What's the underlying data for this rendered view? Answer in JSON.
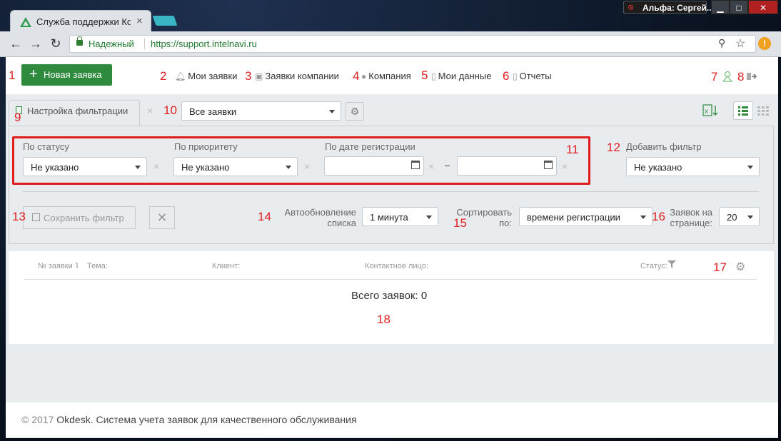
{
  "browser": {
    "tab_title": "Служба поддержки Ком",
    "tab_close": "×",
    "user_badge": "Альфа: Сергей...",
    "secure_label": "Надежный",
    "url": "https://support.intelnavi.ru",
    "window_buttons": [
      "▁",
      "□",
      "✕"
    ]
  },
  "header": {
    "new_ticket_label": "Новая заявка",
    "nav": [
      {
        "label": "Мои заявки",
        "icon": "bell-icon"
      },
      {
        "label": "Заявки компании",
        "icon": "briefcase-icon"
      },
      {
        "label": "Компания",
        "icon": "person-icon"
      },
      {
        "label": "Мои данные",
        "icon": "document-icon"
      },
      {
        "label": "Отчеты",
        "icon": "report-icon"
      }
    ]
  },
  "filter": {
    "tab_label": "Настройка фильтрации",
    "preset_value": "Все заявки",
    "fields": {
      "status_label": "По статусу",
      "status_value": "Не указано",
      "priority_label": "По приоритету",
      "priority_value": "Не указано",
      "date_label": "По дате регистрации",
      "date_from": "",
      "date_to": "",
      "date_dash": "–"
    },
    "add_filter_label": "Добавить фильтр",
    "add_filter_value": "Не указано",
    "save_label": "Сохранить фильтр",
    "autoupdate_label_1": "Автообновление",
    "autoupdate_label_2": "списка",
    "autoupdate_value": "1 минута",
    "sort_label_1": "Сортировать",
    "sort_label_2": "по:",
    "sort_value": "времени регистрации",
    "per_page_label_1": "Заявок на",
    "per_page_label_2": "странице:",
    "per_page_value": "20"
  },
  "table": {
    "columns": [
      "№ заявки",
      "Тема:",
      "Клиент:",
      "Контактное лицо:",
      "Статус:"
    ],
    "total_text": "Всего заявок: 0"
  },
  "footer": {
    "copyright": "© 2017",
    "text": "Okdesk. Система учета заявок для качественного обслуживания"
  },
  "annotations": [
    "1",
    "2",
    "3",
    "4",
    "5",
    "6",
    "7",
    "8",
    "9",
    "10",
    "11",
    "12",
    "13",
    "14",
    "15",
    "16",
    "17",
    "18"
  ],
  "colors": {
    "accent_green": "#2e8b3e",
    "annotation_red": "#e02020"
  }
}
